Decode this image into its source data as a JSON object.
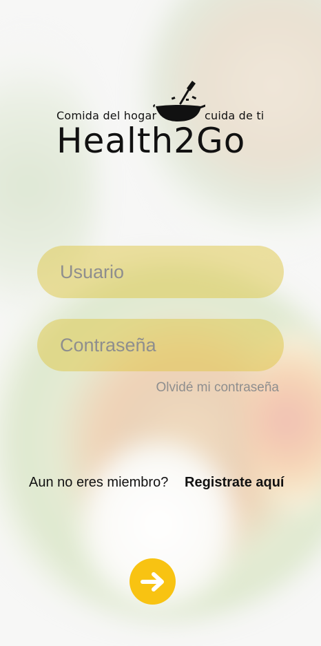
{
  "brand": {
    "tagline_left": "Comida del hogar",
    "tagline_right": "cuida de ti",
    "wordmark": "Health2Go",
    "logo_icon": "wok-pan-icon"
  },
  "login": {
    "username_placeholder": "Usuario",
    "password_placeholder": "Contraseña",
    "forgot_password": "Olvidé mi contraseña"
  },
  "signup": {
    "prompt": "Aun no eres miembro?",
    "link": "Registrate aquí"
  },
  "submit": {
    "icon": "arrow-right-icon"
  },
  "colors": {
    "accent": "#F8C312",
    "field_fill": "#DEC43F",
    "placeholder": "#8E8E8E",
    "text": "#111111"
  }
}
